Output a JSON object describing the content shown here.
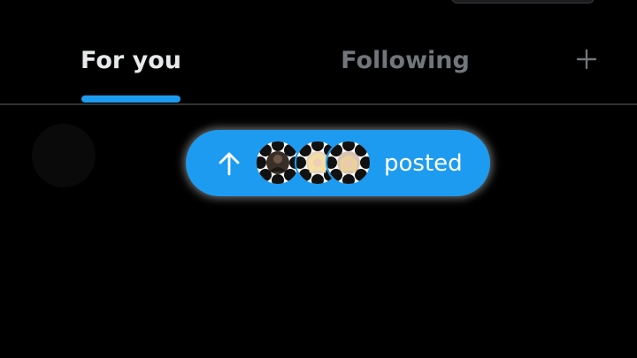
{
  "tabs": [
    {
      "label": "For you",
      "selected": true
    },
    {
      "label": "Following",
      "selected": false
    }
  ],
  "add_tab_icon": "plus-icon",
  "new_posts": {
    "icon": "arrow-up-icon",
    "label": "posted",
    "avatars": [
      "daisy-avatar",
      "daisy-avatar",
      "daisy-avatar"
    ]
  },
  "colors": {
    "background": "#000000",
    "accent": "#1d9bf0",
    "active_tab": "#e7e9ea",
    "inactive_tab": "#71767b",
    "divider": "#2f3336"
  }
}
